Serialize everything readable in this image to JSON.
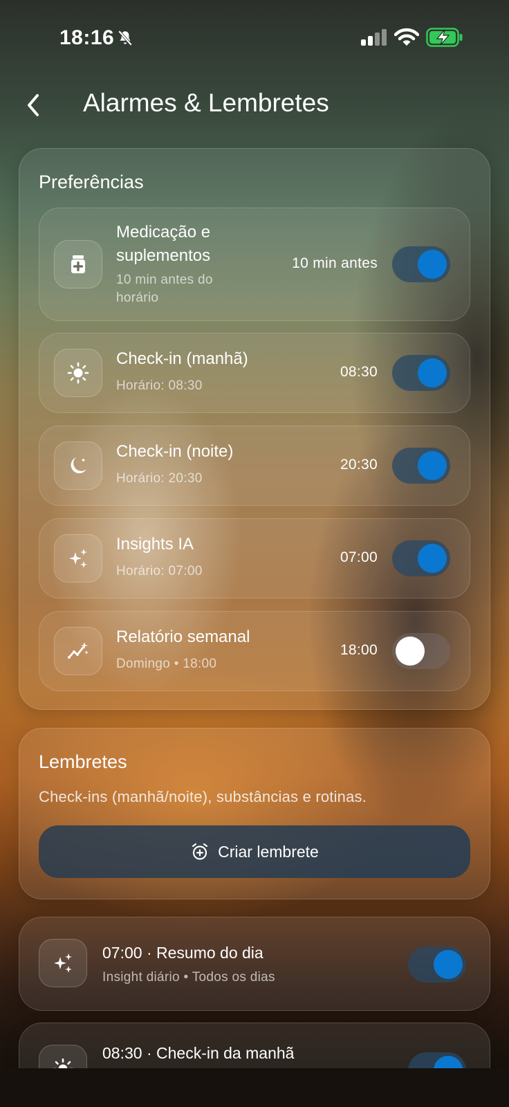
{
  "status_bar": {
    "time": "18:16",
    "icons": [
      "bell-muted-icon",
      "cellular-signal-icon",
      "wifi-icon",
      "battery-charging-icon"
    ],
    "battery_color": "#34c759"
  },
  "header": {
    "title": "Alarmes & Lembretes",
    "back_icon": "chevron-left-icon"
  },
  "preferences": {
    "title": "Preferências",
    "items": [
      {
        "icon": "medication-icon",
        "title_line1": "Medicação e",
        "title_line2": "suplementos",
        "subtitle_line1": "10 min antes do",
        "subtitle_line2": "horário",
        "value": "10 min antes",
        "enabled": true
      },
      {
        "icon": "sun-icon",
        "title": "Check-in (manhã)",
        "subtitle": "Horário: 08:30",
        "value": "08:30",
        "enabled": true
      },
      {
        "icon": "moon-icon",
        "title": "Check-in (noite)",
        "subtitle": "Horário: 20:30",
        "value": "20:30",
        "enabled": true
      },
      {
        "icon": "sparkles-icon",
        "title": "Insights IA",
        "subtitle": "Horário: 07:00",
        "value": "07:00",
        "enabled": true
      },
      {
        "icon": "trend-chart-icon",
        "title": "Relatório semanal",
        "subtitle": "Domingo • 18:00",
        "value": "18:00",
        "enabled": false
      }
    ]
  },
  "reminders": {
    "title": "Lembretes",
    "description": "Check-ins (manhã/noite), substâncias e rotinas.",
    "create_button": "Criar lembrete",
    "create_icon": "alarm-plus-icon",
    "list": [
      {
        "icon": "sparkles-icon",
        "title": "07:00 · Resumo do dia",
        "subtitle": "Insight diário • Todos os dias",
        "enabled": true
      },
      {
        "icon": "sun-icon",
        "title": "08:30 · Check-in da manhã",
        "enabled": true
      }
    ]
  },
  "colors": {
    "toggle_on": "#0a78d0",
    "toggle_off_knob": "#ffffff"
  }
}
